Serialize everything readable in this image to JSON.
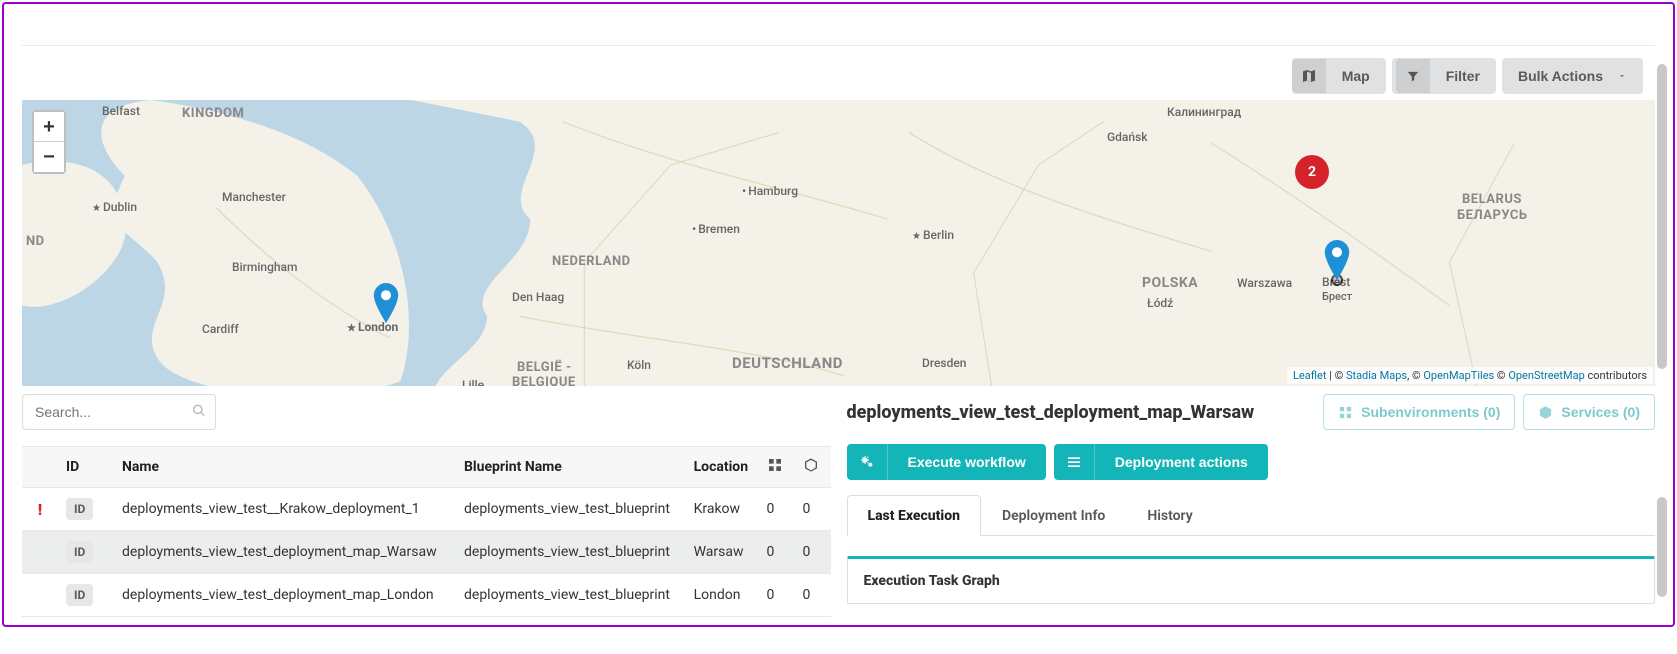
{
  "toolbar": {
    "map_label": "Map",
    "filter_label": "Filter",
    "bulk_label": "Bulk Actions"
  },
  "map": {
    "zoom_in": "+",
    "zoom_out": "−",
    "cluster_count": "2",
    "attribution": {
      "leaflet": "Leaflet",
      "sep1": " | © ",
      "stadia": "Stadia Maps",
      "sep2": ", © ",
      "omt": "OpenMapTiles",
      "sep3": " © ",
      "osm": "OpenStreetMap",
      "suffix": " contributors"
    },
    "labels": {
      "belfast": "Belfast",
      "kingdom": "KINGDOM",
      "dublin": "Dublin",
      "manchester": "Manchester",
      "birmingham": "Birmingham",
      "cardiff": "Cardiff",
      "london": "London",
      "nd": "ND",
      "lille": "Lille",
      "belgie": "BELGIË -",
      "belgique": "BELGIQUE",
      "denhaag": "Den Haag",
      "nederland": "NEDERLAND",
      "koln": "Köln",
      "bremen": "Bremen",
      "hamburg": "Hamburg",
      "berlin": "Berlin",
      "deutschland": "DEUTSCHLAND",
      "dresden": "Dresden",
      "gdansk": "Gdańsk",
      "kaliningrad": "Калининград",
      "polska": "POLSKA",
      "lodz": "Łódź",
      "warszawa": "Warszawa",
      "brest": "Brest",
      "brest_cyr": "Брест",
      "belarus": "BELARUS",
      "belarus_cyr": "БЕЛАРУСЬ"
    }
  },
  "search": {
    "placeholder": "Search..."
  },
  "table": {
    "headers": {
      "status": "",
      "id": "ID",
      "name": "Name",
      "blueprint": "Blueprint Name",
      "location": "Location",
      "col1": "",
      "col2": ""
    },
    "id_chip": "ID",
    "rows": [
      {
        "status": "error",
        "name": "deployments_view_test__Krakow_deployment_1",
        "blueprint": "deployments_view_test_blueprint",
        "location": "Krakow",
        "c1": "0",
        "c2": "0",
        "selected": false
      },
      {
        "status": "",
        "name": "deployments_view_test_deployment_map_Warsaw",
        "blueprint": "deployments_view_test_blueprint",
        "location": "Warsaw",
        "c1": "0",
        "c2": "0",
        "selected": true
      },
      {
        "status": "",
        "name": "deployments_view_test_deployment_map_London",
        "blueprint": "deployments_view_test_blueprint",
        "location": "London",
        "c1": "0",
        "c2": "0",
        "selected": false
      }
    ]
  },
  "detail": {
    "title": "deployments_view_test_deployment_map_Warsaw",
    "subenv_label": "Subenvironments (0)",
    "services_label": "Services (0)",
    "execute_label": "Execute workflow",
    "actions_label": "Deployment actions",
    "tabs": {
      "last_exec": "Last Execution",
      "deploy_info": "Deployment Info",
      "history": "History"
    },
    "task_graph_title": "Execution Task Graph"
  }
}
